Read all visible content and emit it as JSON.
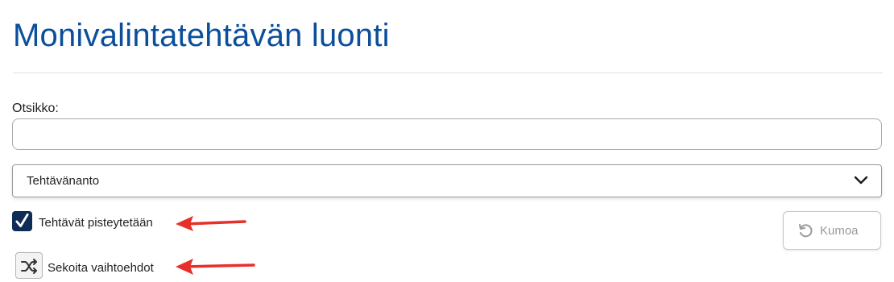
{
  "page": {
    "title": "Monivalintatehtävän luonti"
  },
  "form": {
    "title_label": "Otsikko:",
    "title_value": "",
    "title_placeholder": "",
    "assignment_select": {
      "selected": "Tehtävänanto"
    },
    "scoring_checkbox": {
      "label": "Tehtävät pisteytetään",
      "checked": true
    },
    "shuffle": {
      "label": "Sekoita vaihtoehdot"
    },
    "undo_button": {
      "label": "Kumoa",
      "enabled": false
    }
  },
  "icons": {
    "checkbox": "check-icon",
    "select": "chevron-down-icon",
    "shuffle": "shuffle-icon",
    "undo": "undo-icon",
    "annotation": "red-arrow-icon"
  },
  "colors": {
    "title": "#0b4f9c",
    "checkbox_fill": "#0e2c55",
    "annotation_arrow": "#e8302a",
    "disabled_text": "#9a9a9a"
  }
}
